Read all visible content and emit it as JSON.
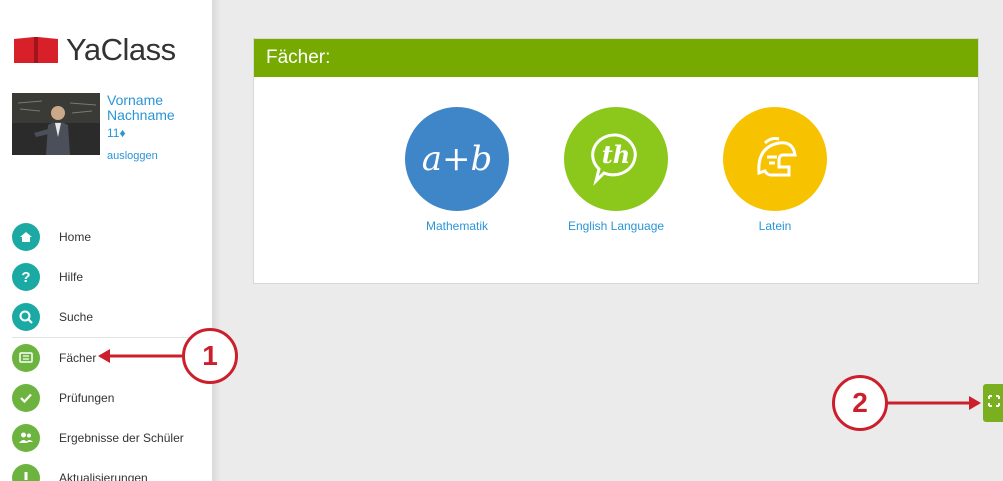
{
  "app": {
    "logo_text": "YaClass"
  },
  "profile": {
    "first_name": "Vorname",
    "last_name": "Nachname",
    "points": "11♦",
    "logout_label": "ausloggen"
  },
  "nav": {
    "items": [
      {
        "label": "Home",
        "icon": "home-icon",
        "color": "#1ba9a4"
      },
      {
        "label": "Hilfe",
        "icon": "help-icon",
        "color": "#1ba9a4"
      },
      {
        "label": "Suche",
        "icon": "search-icon",
        "color": "#1ba9a4"
      },
      {
        "label": "Fächer",
        "icon": "subjects-icon",
        "color": "#6db33f"
      },
      {
        "label": "Prüfungen",
        "icon": "check-icon",
        "color": "#6db33f"
      },
      {
        "label": "Ergebnisse der Schüler",
        "icon": "users-icon",
        "color": "#6db33f"
      },
      {
        "label": "Aktualisierungen",
        "icon": "exclamation-icon",
        "color": "#6db33f"
      }
    ]
  },
  "main": {
    "panel_title": "Fächer:",
    "header_color": "#77aa00",
    "subjects": [
      {
        "label": "Mathematik",
        "glyph": "a+b",
        "color": "#3f86c8",
        "icon": "math-icon"
      },
      {
        "label": "English Language",
        "glyph": "th",
        "color": "#8cc81b",
        "icon": "speech-bubble-icon"
      },
      {
        "label": "Latein",
        "glyph": "",
        "color": "#f7c300",
        "icon": "helmet-icon"
      }
    ]
  },
  "annotations": {
    "callout_1": "1",
    "callout_2": "2",
    "accent_color": "#cc1f2c"
  }
}
